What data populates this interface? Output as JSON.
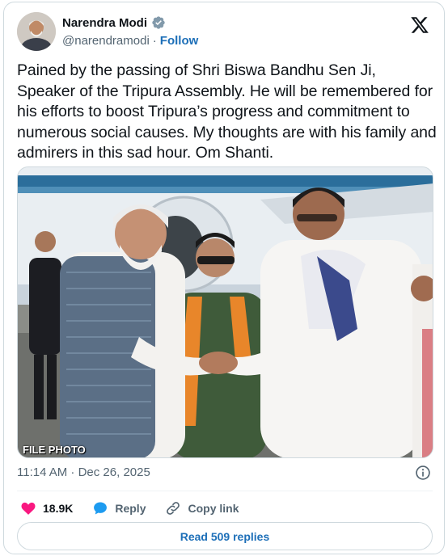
{
  "author": {
    "name": "Narendra Modi",
    "handle": "@narendramodi",
    "separator": "·",
    "follow_label": "Follow"
  },
  "tweet": {
    "text": "Pained by the passing of Shri Biswa Bandhu Sen Ji, Speaker of the Tripura Assembly. He will be remembered for his efforts to boost Tripura’s progress and commitment to numerous social causes. My thoughts are with his family and admirers in this sad hour. Om Shanti.",
    "photo_caption": "FILE PHOTO",
    "timestamp": "11:14 AM · Dec 26, 2025"
  },
  "actions": {
    "likes": "18.9K",
    "reply_label": "Reply",
    "copy_link_label": "Copy link"
  },
  "replies_button": "Read 509 replies",
  "colors": {
    "accent": "#1d6fb8",
    "like": "#f91880",
    "verified": "#829aab",
    "muted": "#536471"
  },
  "icons": {
    "brand": "x-logo-icon",
    "verified": "verified-badge-icon",
    "info": "info-icon",
    "like": "heart-icon",
    "reply": "speech-bubble-icon",
    "copy": "link-icon"
  }
}
